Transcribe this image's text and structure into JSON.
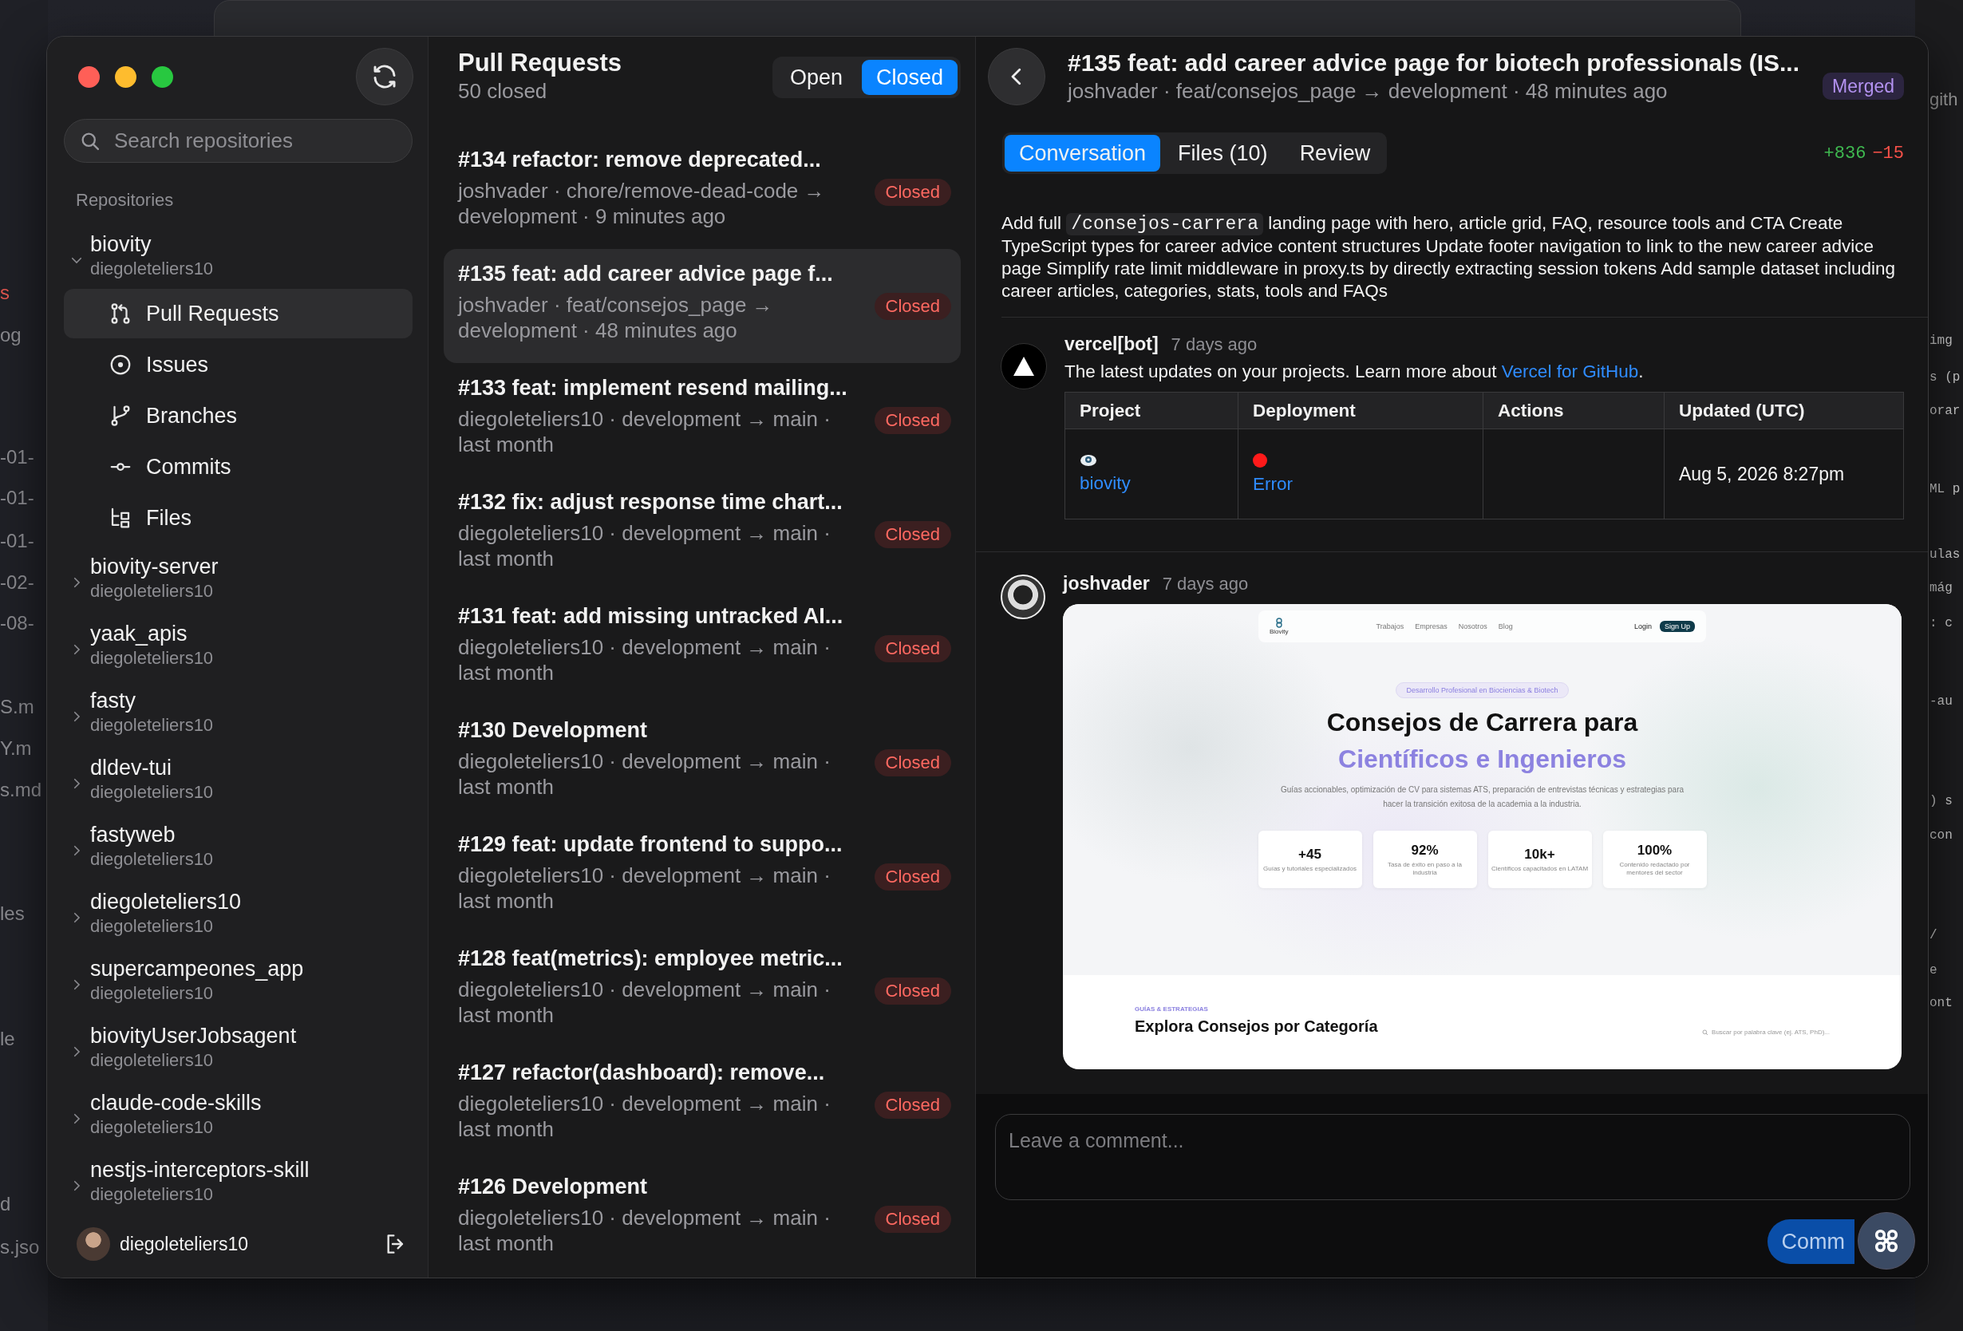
{
  "desktop": {
    "left_fragments": [
      {
        "text": "s",
        "color": "#e0564f"
      },
      {
        "text": "og",
        "color": "#8a8a8f"
      },
      {
        "text": "-01-",
        "color": "#8a8a8f"
      },
      {
        "text": "-01-",
        "color": "#8a8a8f"
      },
      {
        "text": "-01-",
        "color": "#8a8a8f"
      },
      {
        "text": "-02-",
        "color": "#8a8a8f"
      },
      {
        "text": "-08-",
        "color": "#8a8a8f"
      },
      {
        "text": "S.m",
        "color": "#8a8a8f"
      },
      {
        "text": "Y.m",
        "color": "#8a8a8f"
      },
      {
        "text": "s.md",
        "color": "#8a8a8f"
      },
      {
        "text": "les",
        "color": "#8a8a8f"
      },
      {
        "text": "le",
        "color": "#8a8a8f"
      },
      {
        "text": "d",
        "color": "#8a8a8f"
      },
      {
        "text": "s.jso",
        "color": "#8a8a8f"
      }
    ],
    "right_fragments": [
      "gith",
      "img",
      "s (p",
      "orar",
      "ML p",
      "ulas",
      "mág",
      ": c",
      "-au",
      ") s",
      "con",
      "/",
      "e",
      "ont"
    ]
  },
  "sidebar": {
    "search": {
      "placeholder": "Search repositories"
    },
    "section_label": "Repositories",
    "repositories": [
      {
        "name": "biovity",
        "owner": "diegoleteliers10",
        "expanded": true,
        "children": [
          {
            "label": "Pull Requests",
            "kind": "pull-requests",
            "selected": true
          },
          {
            "label": "Issues",
            "kind": "issues",
            "selected": false
          },
          {
            "label": "Branches",
            "kind": "branches",
            "selected": false
          },
          {
            "label": "Commits",
            "kind": "commits",
            "selected": false
          },
          {
            "label": "Files",
            "kind": "files",
            "selected": false
          }
        ]
      },
      {
        "name": "biovity-server",
        "owner": "diegoleteliers10",
        "expanded": false
      },
      {
        "name": "yaak_apis",
        "owner": "diegoleteliers10",
        "expanded": false
      },
      {
        "name": "fasty",
        "owner": "diegoleteliers10",
        "expanded": false
      },
      {
        "name": "dldev-tui",
        "owner": "diegoleteliers10",
        "expanded": false
      },
      {
        "name": "fastyweb",
        "owner": "diegoleteliers10",
        "expanded": false
      },
      {
        "name": "diegoleteliers10",
        "owner": "diegoleteliers10",
        "expanded": false
      },
      {
        "name": "supercampeones_app",
        "owner": "diegoleteliers10",
        "expanded": false
      },
      {
        "name": "biovityUserJobsagent",
        "owner": "diegoleteliers10",
        "expanded": false
      },
      {
        "name": "claude-code-skills",
        "owner": "diegoleteliers10",
        "expanded": false
      },
      {
        "name": "nestjs-interceptors-skill",
        "owner": "diegoleteliers10",
        "expanded": false
      }
    ],
    "user": {
      "name": "diegoleteliers10"
    }
  },
  "pull_requests": {
    "title": "Pull Requests",
    "count": "50 closed",
    "filters": [
      {
        "label": "Open",
        "selected": false
      },
      {
        "label": "Closed",
        "selected": true
      }
    ],
    "items": [
      {
        "title": "#134 refactor: remove deprecated...",
        "meta": "joshvader · chore/remove-dead-code → development · 9 minutes ago",
        "status": "Closed",
        "selected": false
      },
      {
        "title": "#135 feat: add career advice page f...",
        "meta": "joshvader · feat/consejos_page → development · 48 minutes ago",
        "status": "Closed",
        "selected": true
      },
      {
        "title": "#133 feat: implement resend mailing...",
        "meta": "diegoleteliers10 · development → main · last month",
        "status": "Closed",
        "selected": false
      },
      {
        "title": "#132 fix: adjust response time chart...",
        "meta": "diegoleteliers10 · development → main · last month",
        "status": "Closed",
        "selected": false
      },
      {
        "title": "#131 feat: add missing untracked AI...",
        "meta": "diegoleteliers10 · development → main · last month",
        "status": "Closed",
        "selected": false
      },
      {
        "title": "#130 Development",
        "meta": "diegoleteliers10 · development → main · last month",
        "status": "Closed",
        "selected": false
      },
      {
        "title": "#129 feat: update frontend to suppo...",
        "meta": "diegoleteliers10 · development → main · last month",
        "status": "Closed",
        "selected": false
      },
      {
        "title": "#128 feat(metrics): employee metric...",
        "meta": "diegoleteliers10 · development → main · last month",
        "status": "Closed",
        "selected": false
      },
      {
        "title": "#127 refactor(dashboard): remove...",
        "meta": "diegoleteliers10 · development → main · last month",
        "status": "Closed",
        "selected": false
      },
      {
        "title": "#126 Development",
        "meta": "diegoleteliers10 · development → main · last month",
        "status": "Closed",
        "selected": false
      }
    ]
  },
  "detail": {
    "title": "#135 feat: add career advice page for biotech professionals (IS...",
    "subtitle": "joshvader · feat/consejos_page → development · 48 minutes ago",
    "status": "Merged",
    "tabs": [
      {
        "label": "Conversation",
        "selected": true
      },
      {
        "label": "Files (10)",
        "selected": false
      },
      {
        "label": "Review",
        "selected": false
      }
    ],
    "additions": "+836",
    "deletions": "−15",
    "description": {
      "before": "Add full",
      "code": "/consejos-carrera",
      "after": "landing page with hero, article grid, FAQ, resource tools and CTA Create TypeScript types for career advice content structures Update footer navigation to link to the new career advice page Simplify rate limit middleware in proxy.ts by directly extracting session tokens Add sample dataset including career articles, categories, stats, tools and FAQs"
    },
    "comments": [
      {
        "kind": "bot",
        "author": "vercel[bot]",
        "time": "7 days ago",
        "text": "The latest updates on your projects. Learn more about",
        "link": "Vercel for GitHub",
        "after_link": ".",
        "table": {
          "columns": [
            "Project",
            "Deployment",
            "Actions",
            "Updated (UTC)"
          ],
          "rows": [
            {
              "project": "biovity",
              "deployment": "Error",
              "updated": "Aug 5, 2026 8:27pm"
            }
          ]
        }
      },
      {
        "kind": "user",
        "author": "joshvader",
        "time": "7 days ago",
        "attachment": {
          "logo": "Biovity",
          "nav": [
            "Trabajos",
            "Empresas",
            "Nosotros",
            "Blog"
          ],
          "login": "Login",
          "signup": "Sign Up",
          "pill": "Desarrollo Profesional en Biociencias & Biotech",
          "heading": "Consejos de Carrera para",
          "heading_accent": "Científicos e Ingenieros",
          "lead": "Guías accionables, optimización de CV para sistemas ATS, preparación de entrevistas técnicas y estrategias para hacer la transición exitosa de la academia a la industria.",
          "stats": [
            {
              "value": "+45",
              "label": "Guías y tutoriales especializados"
            },
            {
              "value": "92%",
              "label": "Tasa de éxito en paso a la industria"
            },
            {
              "value": "10k+",
              "label": "Científicos capacitados en LATAM"
            },
            {
              "value": "100%",
              "label": "Contenido redactado por mentores del sector"
            }
          ],
          "eyebrow": "GUÍAS & ESTRATEGIAS",
          "section_title": "Explora Consejos por Categoría",
          "search_placeholder": "Buscar por palabra clave (ej. ATS, PhD)..."
        }
      }
    ],
    "comment_box": {
      "placeholder": "Leave a comment...",
      "button": "Comm"
    }
  }
}
